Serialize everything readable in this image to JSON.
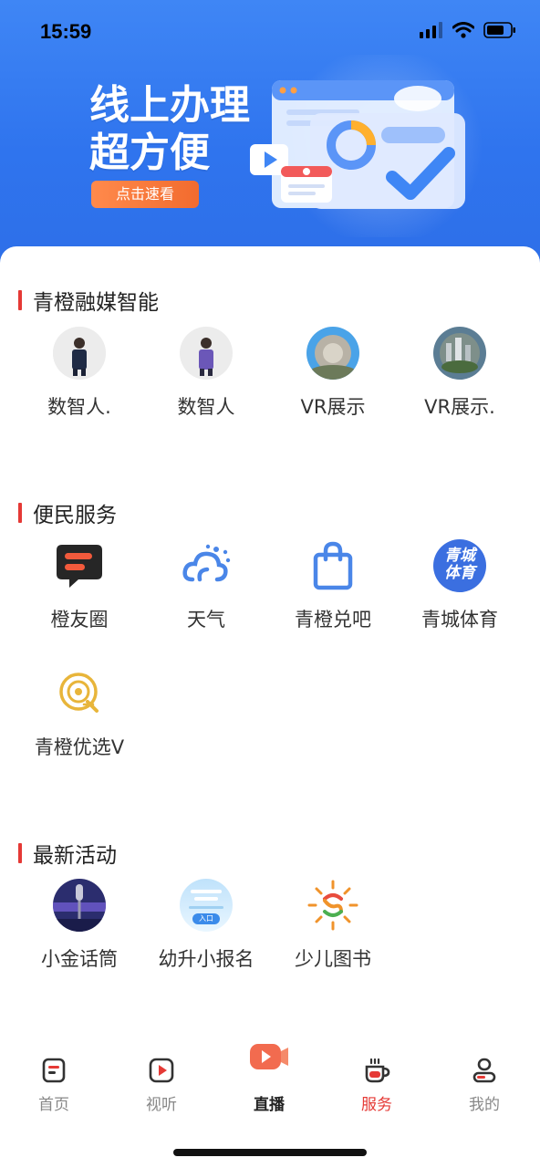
{
  "status": {
    "time": "15:59"
  },
  "banner": {
    "title_line1": "线上办理",
    "title_line2": "超方便",
    "cta": "点击速看"
  },
  "sections": [
    {
      "title": "青橙融媒智能",
      "items": [
        {
          "label": "数智人.",
          "icon": "digital-human-male-avatar"
        },
        {
          "label": "数智人",
          "icon": "digital-human-female-avatar"
        },
        {
          "label": "VR展示",
          "icon": "vr-panorama-thumbnail"
        },
        {
          "label": "VR展示.",
          "icon": "vr-city-thumbnail"
        }
      ]
    },
    {
      "title": "便民服务",
      "items": [
        {
          "label": "橙友圈",
          "icon": "chat-bubble-icon"
        },
        {
          "label": "天气",
          "icon": "weather-icon"
        },
        {
          "label": "青橙兑吧",
          "icon": "shopping-bag-icon"
        },
        {
          "label": "青城体育",
          "icon": "sports-logo-icon",
          "badge_line1": "青城",
          "badge_line2": "体育"
        },
        {
          "label": "青橙优选V",
          "icon": "select-logo-icon"
        }
      ]
    },
    {
      "title": "最新活动",
      "items": [
        {
          "label": "小金话筒",
          "icon": "microphone-event-thumbnail"
        },
        {
          "label": "幼升小报名",
          "icon": "enrollment-thumbnail",
          "thumb_text": "入口"
        },
        {
          "label": "少儿图书",
          "icon": "children-books-logo"
        }
      ]
    }
  ],
  "tabbar": {
    "tabs": [
      {
        "label": "首页",
        "icon": "home-icon",
        "state": "inactive"
      },
      {
        "label": "视听",
        "icon": "play-icon",
        "state": "inactive"
      },
      {
        "label": "直播",
        "icon": "live-icon",
        "state": "live"
      },
      {
        "label": "服务",
        "icon": "coffee-cup-icon",
        "state": "active"
      },
      {
        "label": "我的",
        "icon": "profile-icon",
        "state": "inactive"
      }
    ]
  },
  "colors": {
    "accent": "#e53935",
    "banner_blue": "#3f86f5",
    "icon_blue": "#4a86e8"
  }
}
